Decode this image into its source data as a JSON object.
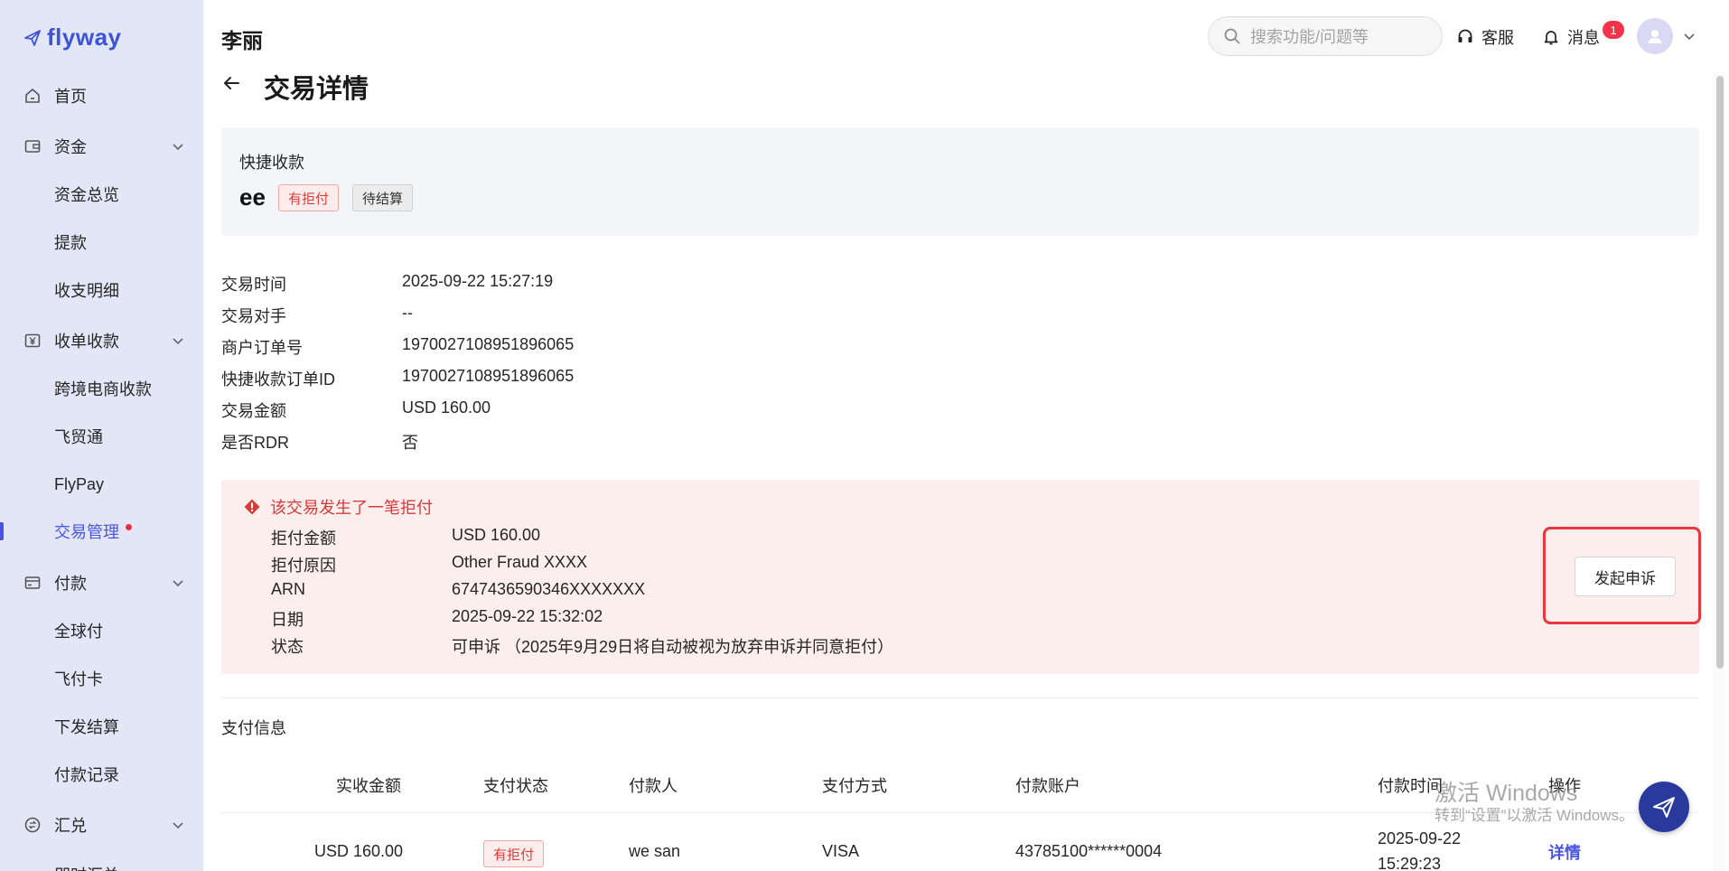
{
  "brand": {
    "logo_text": "flyway",
    "accent": "#4a56e2"
  },
  "sidebar": {
    "items": [
      {
        "label": "首页",
        "icon": "home-icon"
      },
      {
        "label": "资金",
        "icon": "wallet-icon",
        "expandable": true
      },
      {
        "label": "资金总览",
        "sub": true
      },
      {
        "label": "提款",
        "sub": true
      },
      {
        "label": "收支明细",
        "sub": true
      },
      {
        "label": "收单收款",
        "icon": "yuan-icon",
        "expandable": true
      },
      {
        "label": "跨境电商收款",
        "sub": true
      },
      {
        "label": "飞贸通",
        "sub": true
      },
      {
        "label": "FlyPay",
        "sub": true
      },
      {
        "label": "交易管理",
        "sub": true,
        "active": true
      },
      {
        "label": "付款",
        "icon": "card-icon",
        "expandable": true
      },
      {
        "label": "全球付",
        "sub": true
      },
      {
        "label": "飞付卡",
        "sub": true
      },
      {
        "label": "下发结算",
        "sub": true
      },
      {
        "label": "付款记录",
        "sub": true
      },
      {
        "label": "汇兑",
        "icon": "exchange-icon",
        "expandable": true
      },
      {
        "label": "即时汇兑",
        "sub": true
      }
    ]
  },
  "header": {
    "user_name": "李丽",
    "search_placeholder": "搜索功能/问题等",
    "service_label": "客服",
    "messages_label": "消息",
    "messages_badge": "1"
  },
  "page": {
    "title": "交易详情"
  },
  "summary": {
    "type_label": "快捷收款",
    "name": "ee",
    "tag_chargeback": "有拒付",
    "tag_settlement": "待结算"
  },
  "details": [
    {
      "key": "交易时间",
      "value": "2025-09-22 15:27:19"
    },
    {
      "key": "交易对手",
      "value": "--"
    },
    {
      "key": "商户订单号",
      "value": "1970027108951896065"
    },
    {
      "key": "快捷收款订单ID",
      "value": "1970027108951896065"
    },
    {
      "key": "交易金额",
      "value": "USD 160.00"
    },
    {
      "key": "是否RDR",
      "value": "否"
    }
  ],
  "chargeback": {
    "heading": "该交易发生了一笔拒付",
    "rows": [
      {
        "key": "拒付金额",
        "value": "USD 160.00"
      },
      {
        "key": "拒付原因",
        "value": "Other Fraud XXXX"
      },
      {
        "key": "ARN",
        "value": "6747436590346XXXXXXX"
      },
      {
        "key": "日期",
        "value": "2025-09-22 15:32:02"
      },
      {
        "key": "状态",
        "value": "可申诉 （2025年9月29日将自动被视为放弃申诉并同意拒付）"
      }
    ],
    "appeal_button": "发起申诉"
  },
  "payment": {
    "section_title": "支付信息",
    "columns": [
      "实收金额",
      "支付状态",
      "付款人",
      "支付方式",
      "付款账户",
      "付款时间",
      "操作"
    ],
    "row": {
      "amount": "USD 160.00",
      "status": "有拒付",
      "payer": "we san",
      "method": "VISA",
      "account": "43785100******0004",
      "time_date": "2025-09-22",
      "time_clock": "15:29:23",
      "action": "详情"
    }
  },
  "watermark": {
    "line1": "激活 Windows",
    "line2": "转到“设置”以激活 Windows。"
  }
}
